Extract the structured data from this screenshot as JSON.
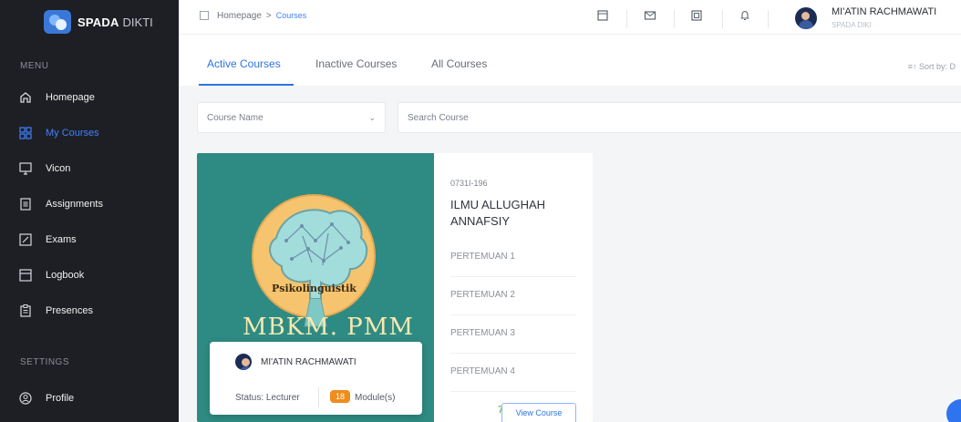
{
  "brand": {
    "main": "SPADA",
    "sub": "DIKTI"
  },
  "sidebar": {
    "menu_label": "MENU",
    "settings_label": "SETTINGS",
    "items": [
      {
        "label": "Homepage",
        "icon": "home-icon",
        "active": false
      },
      {
        "label": "My Courses",
        "icon": "grid-icon",
        "active": true
      },
      {
        "label": "Vicon",
        "icon": "monitor-icon",
        "active": false
      },
      {
        "label": "Assignments",
        "icon": "document-icon",
        "active": false
      },
      {
        "label": "Exams",
        "icon": "pencil-icon",
        "active": false
      },
      {
        "label": "Logbook",
        "icon": "book-icon",
        "active": false
      },
      {
        "label": "Presences",
        "icon": "clipboard-icon",
        "active": false
      }
    ],
    "settings_items": [
      {
        "label": "Profile",
        "icon": "user-icon"
      }
    ]
  },
  "header": {
    "breadcrumb_home": "Homepage",
    "breadcrumb_separator": ">",
    "breadcrumb_current": "Courses",
    "icons": [
      "calendar-icon",
      "mail-icon",
      "message-icon",
      "bell-icon"
    ],
    "user_name": "MI'ATIN RACHMAWATI",
    "user_role": "SPADA DIKI"
  },
  "tabs": {
    "active": "Active Courses",
    "inactive": "Inactive Courses",
    "all": "All Courses",
    "sort": "Sort by: D"
  },
  "filters": {
    "course_name_select": "Course Name",
    "search_placeholder": "Search Course"
  },
  "course": {
    "cover_title": "MBKM. PMM",
    "cover_subtitle": "Psikolinguistik",
    "code": "0731I-196",
    "name": "ILMU ALLUGHAH ANNAFSIY",
    "meetings": [
      "PERTEMUAN 1",
      "PERTEMUAN 2",
      "PERTEMUAN 3",
      "PERTEMUAN 4"
    ],
    "meeting_count": "7",
    "view_button": "View Course",
    "lecturer_name": "MI'ATIN RACHMAWATI",
    "status_label": "Status:",
    "status_value": "Lecturer",
    "module_count": "18",
    "module_label": "Module(s)"
  },
  "colors": {
    "accent": "#2d73e6",
    "sidebar": "#1e1f24",
    "cover": "#2e8b83",
    "badge": "#f08c1b"
  }
}
